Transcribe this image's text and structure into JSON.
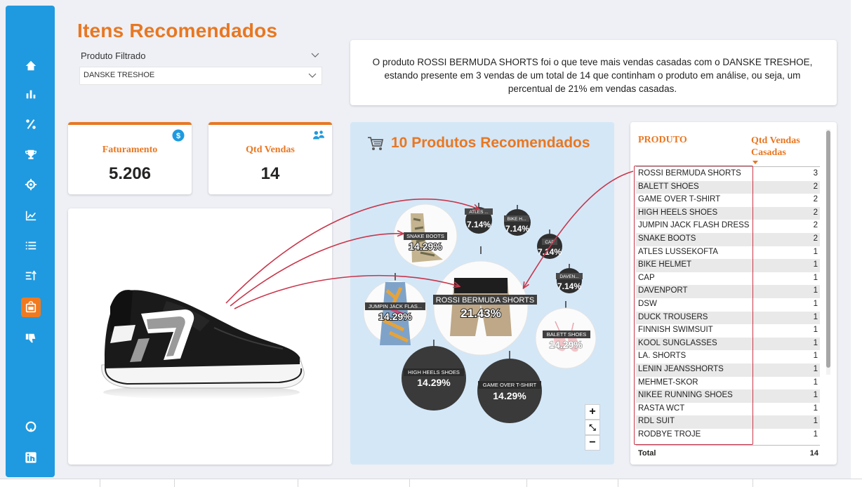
{
  "title": "Itens Recomendados",
  "slicer": {
    "label": "Produto Filtrado",
    "value": "DANSKE TRESHOE"
  },
  "narrative": "O produto ROSSI BERMUDA SHORTS foi o que teve mais vendas casadas com o DANSKE TRESHOE, estando presente em 3 vendas de um total de 14 que continham o produto em análise, ou seja, um percentual de 21% em vendas casadas.",
  "kpis": [
    {
      "label": "Faturamento",
      "value": "5.206",
      "icon": "dollar-coin-icon"
    },
    {
      "label": "Qtd Vendas",
      "value": "14",
      "icon": "people-icon"
    }
  ],
  "bubble_chart": {
    "title": "10 Produtos Recomendados",
    "icon": "cart-icon",
    "bubbles": [
      {
        "label": "ROSSI BERMUDA SHORTS",
        "pct": "21.43%"
      },
      {
        "label": "SNAKE BOOTS",
        "pct": "14.29%"
      },
      {
        "label": "JUMPIN JACK FLAS...",
        "pct": "14.29%"
      },
      {
        "label": "HIGH HEELS SHOES",
        "pct": "14.29%"
      },
      {
        "label": "GAME OVER T-SHIRT",
        "pct": "14.29%"
      },
      {
        "label": "BALETT SHOES",
        "pct": "14.29%"
      },
      {
        "label": "ATLES ...",
        "pct": "7.14%"
      },
      {
        "label": "BIKE H...",
        "pct": "7.14%"
      },
      {
        "label": "CAP",
        "pct": "7.14%"
      },
      {
        "label": "DAVEN...",
        "pct": "7.14%"
      }
    ],
    "zoom": {
      "in": "+",
      "fit": "⤡",
      "out": "−"
    }
  },
  "table": {
    "col_product": "PRODUTO",
    "col_qty": "Qtd Vendas Casadas",
    "rows": [
      {
        "p": "ROSSI BERMUDA SHORTS",
        "q": "3"
      },
      {
        "p": "BALETT SHOES",
        "q": "2"
      },
      {
        "p": "GAME OVER T-SHIRT",
        "q": "2"
      },
      {
        "p": "HIGH HEELS SHOES",
        "q": "2"
      },
      {
        "p": "JUMPIN JACK FLASH DRESS",
        "q": "2"
      },
      {
        "p": "SNAKE BOOTS",
        "q": "2"
      },
      {
        "p": "ATLES LUSSEKOFTA",
        "q": "1"
      },
      {
        "p": "BIKE HELMET",
        "q": "1"
      },
      {
        "p": "CAP",
        "q": "1"
      },
      {
        "p": "DAVENPORT",
        "q": "1"
      },
      {
        "p": "DSW",
        "q": "1"
      },
      {
        "p": "DUCK TROUSERS",
        "q": "1"
      },
      {
        "p": "FINNISH SWIMSUIT",
        "q": "1"
      },
      {
        "p": "KOOL SUNGLASSES",
        "q": "1"
      },
      {
        "p": "LA. SHORTS",
        "q": "1"
      },
      {
        "p": "LENIN JEANSSHORTS",
        "q": "1"
      },
      {
        "p": "MEHMET-SKOR",
        "q": "1"
      },
      {
        "p": "NIKEE RUNNING SHOES",
        "q": "1"
      },
      {
        "p": "RASTA WCT",
        "q": "1"
      },
      {
        "p": "RDL SUIT",
        "q": "1"
      },
      {
        "p": "RODBYE TROJE",
        "q": "1"
      }
    ],
    "total_label": "Total",
    "total_value": "14"
  },
  "nav_icons": [
    "home-icon",
    "bar-chart-icon",
    "percent-icon",
    "trophy-icon",
    "target-icon",
    "line-chart-icon",
    "list-icon",
    "sort-list-icon",
    "cart-page-icon",
    "thumbs-down-icon",
    "github-icon",
    "linkedin-icon"
  ],
  "colors": {
    "accent": "#e87722",
    "sidebar": "#1f9ae0",
    "highlight": "#c8364b",
    "bubble_panel": "#d4e7f7"
  }
}
